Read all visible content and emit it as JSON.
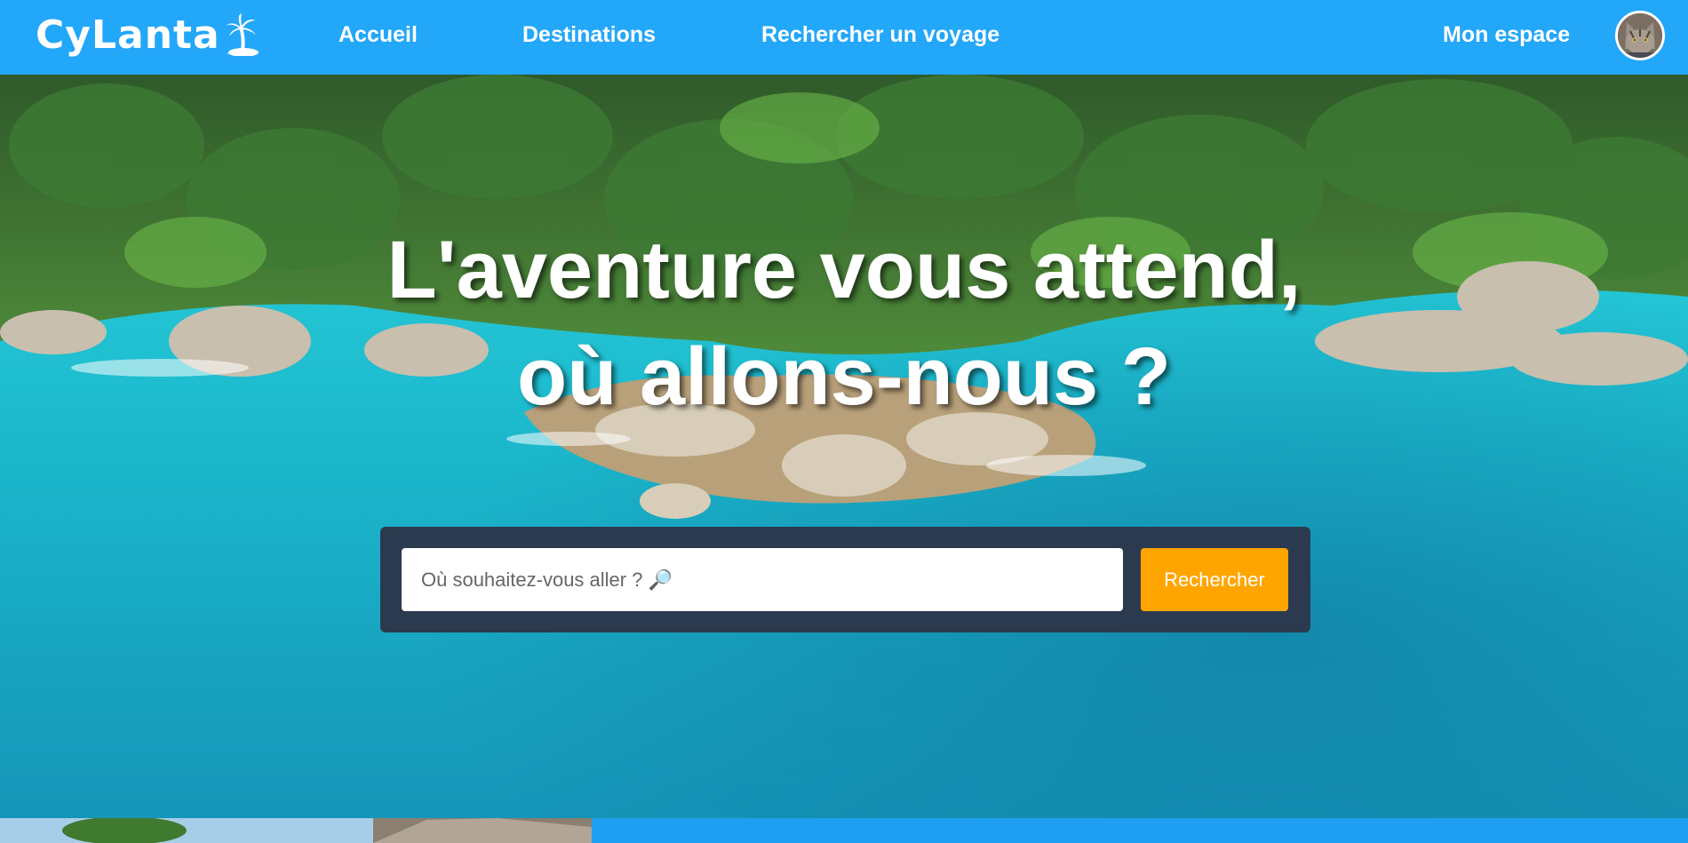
{
  "header": {
    "logo_text": "CyLanta",
    "nav": {
      "accueil": "Accueil",
      "destinations": "Destinations",
      "recherche": "Rechercher un voyage"
    },
    "account_label": "Mon espace"
  },
  "hero": {
    "title_line1": "L'aventure vous attend,",
    "title_line2": "où allons-nous ?"
  },
  "search": {
    "placeholder": "Où souhaitez-vous aller ? 🔎",
    "button_label": "Rechercher"
  },
  "colors": {
    "header_bg": "#23a7f8",
    "search_panel_bg": "#2b3a4e",
    "search_button_bg": "#ffa500"
  },
  "icons": {
    "logo": "palm-tree-island-icon",
    "avatar": "cat-avatar",
    "search": "magnifying-glass-icon"
  }
}
